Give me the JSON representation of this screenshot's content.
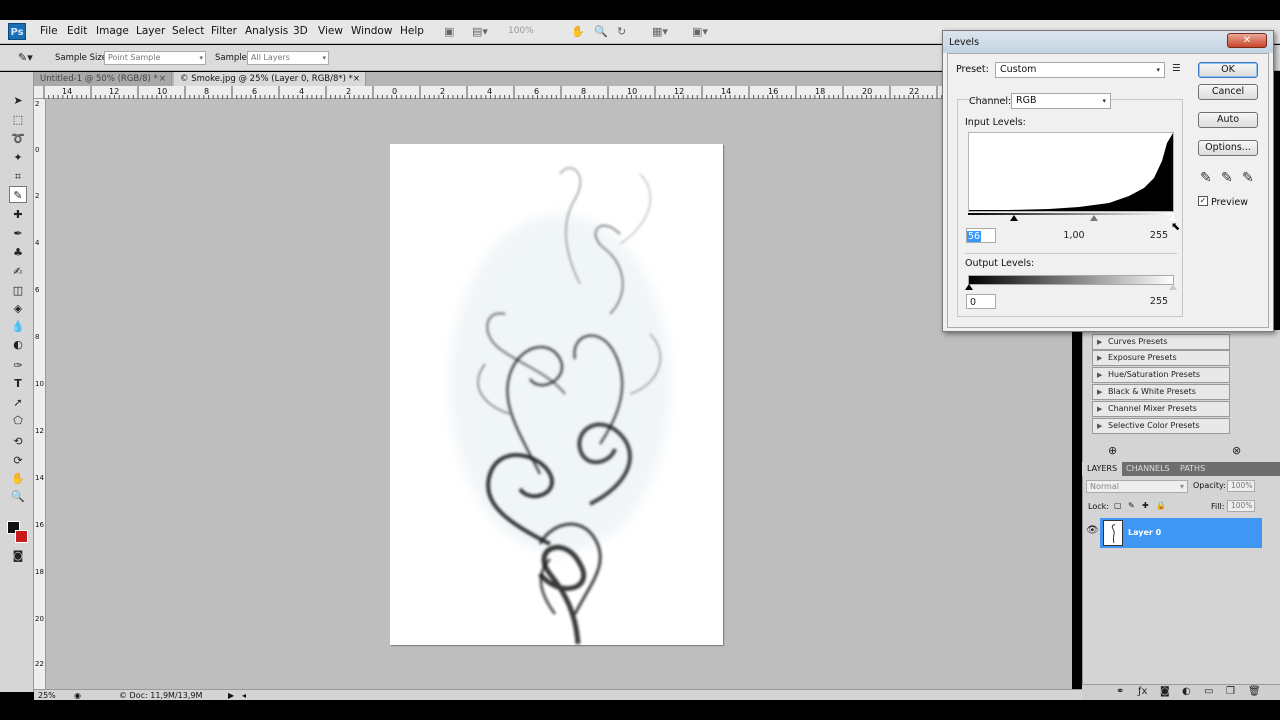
{
  "app": {
    "logo": "Ps",
    "menu": [
      "File",
      "Edit",
      "Image",
      "Layer",
      "Select",
      "Filter",
      "Analysis",
      "3D",
      "View",
      "Window",
      "Help"
    ],
    "zoom": "100%"
  },
  "options_bar": {
    "sample_size_label": "Sample Size:",
    "sample_size_value": "Point Sample",
    "sample_label": "Sample:",
    "sample_value": "All Layers"
  },
  "tabs": [
    {
      "label": "Untitled-1 @ 50% (RGB/8) *",
      "active": false
    },
    {
      "label": "© Smoke.jpg @ 25% (Layer 0, RGB/8*) *",
      "active": true
    }
  ],
  "rulers": {
    "top": [
      "14",
      "12",
      "10",
      "8",
      "6",
      "4",
      "2",
      "0",
      "2",
      "4",
      "6",
      "8",
      "10",
      "12",
      "14",
      "16",
      "18",
      "20",
      "22"
    ],
    "left": [
      "2",
      "0",
      "2",
      "4",
      "6",
      "8",
      "10",
      "12",
      "14",
      "16",
      "18",
      "20",
      "22",
      "24",
      "26"
    ]
  },
  "status": {
    "zoom": "25%",
    "doc": "Doc: 11,9M/13,9M"
  },
  "levels": {
    "title": "Levels",
    "close": "✕",
    "preset_label": "Preset:",
    "preset_value": "Custom",
    "channel_label": "Channel:",
    "channel_value": "RGB",
    "input_label": "Input Levels:",
    "input_black": "56",
    "input_gamma": "1,00",
    "input_white": "255",
    "output_label": "Output Levels:",
    "output_black": "0",
    "output_white": "255",
    "buttons": {
      "ok": "OK",
      "cancel": "Cancel",
      "auto": "Auto",
      "options": "Options..."
    },
    "preview_label": "Preview",
    "preview_checked": "✓"
  },
  "adjustment_presets": [
    "Curves Presets",
    "Exposure Presets",
    "Hue/Saturation Presets",
    "Black & White Presets",
    "Channel Mixer Presets",
    "Selective Color Presets"
  ],
  "layers_panel": {
    "tabs": [
      "LAYERS",
      "CHANNELS",
      "PATHS"
    ],
    "blend_mode": "Normal",
    "opacity_label": "Opacity:",
    "opacity_value": "100%",
    "lock_label": "Lock:",
    "fill_label": "Fill:",
    "fill_value": "100%",
    "layer_name": "Layer 0"
  }
}
